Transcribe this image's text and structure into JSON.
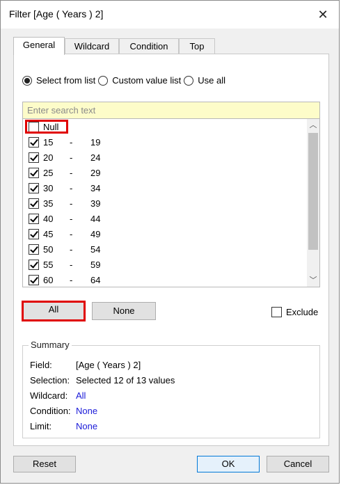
{
  "window": {
    "title": "Filter [Age ( Years ) 2]",
    "close_glyph": "✕"
  },
  "tabs": [
    {
      "label": "General",
      "active": true
    },
    {
      "label": "Wildcard",
      "active": false
    },
    {
      "label": "Condition",
      "active": false
    },
    {
      "label": "Top",
      "active": false
    }
  ],
  "selection_mode": {
    "options": [
      {
        "label": "Select from list",
        "checked": true
      },
      {
        "label": "Custom value list",
        "checked": false
      },
      {
        "label": "Use all",
        "checked": false
      }
    ]
  },
  "search": {
    "placeholder": "Enter search text",
    "value": ""
  },
  "list": {
    "items": [
      {
        "from": "Null",
        "to": "",
        "checked": false
      },
      {
        "from": "15",
        "to": "19",
        "checked": true
      },
      {
        "from": "20",
        "to": "24",
        "checked": true
      },
      {
        "from": "25",
        "to": "29",
        "checked": true
      },
      {
        "from": "30",
        "to": "34",
        "checked": true
      },
      {
        "from": "35",
        "to": "39",
        "checked": true
      },
      {
        "from": "40",
        "to": "44",
        "checked": true
      },
      {
        "from": "45",
        "to": "49",
        "checked": true
      },
      {
        "from": "50",
        "to": "54",
        "checked": true
      },
      {
        "from": "55",
        "to": "59",
        "checked": true
      },
      {
        "from": "60",
        "to": "64",
        "checked": true
      }
    ],
    "separator": "-"
  },
  "buttons": {
    "all": "All",
    "none": "None",
    "exclude_label": "Exclude",
    "exclude_checked": false
  },
  "summary": {
    "legend": "Summary",
    "rows": [
      {
        "key": "Field:",
        "value": "[Age ( Years ) 2]",
        "link": false
      },
      {
        "key": "Selection:",
        "value": "Selected 12 of 13 values",
        "link": false
      },
      {
        "key": "Wildcard:",
        "value": "All",
        "link": true
      },
      {
        "key": "Condition:",
        "value": "None",
        "link": true
      },
      {
        "key": "Limit:",
        "value": "None",
        "link": true
      }
    ]
  },
  "footer": {
    "reset": "Reset",
    "ok": "OK",
    "cancel": "Cancel"
  },
  "colors": {
    "highlight": "#e00000",
    "search_bg": "#fdfcc9",
    "link": "#1a1ad8"
  }
}
